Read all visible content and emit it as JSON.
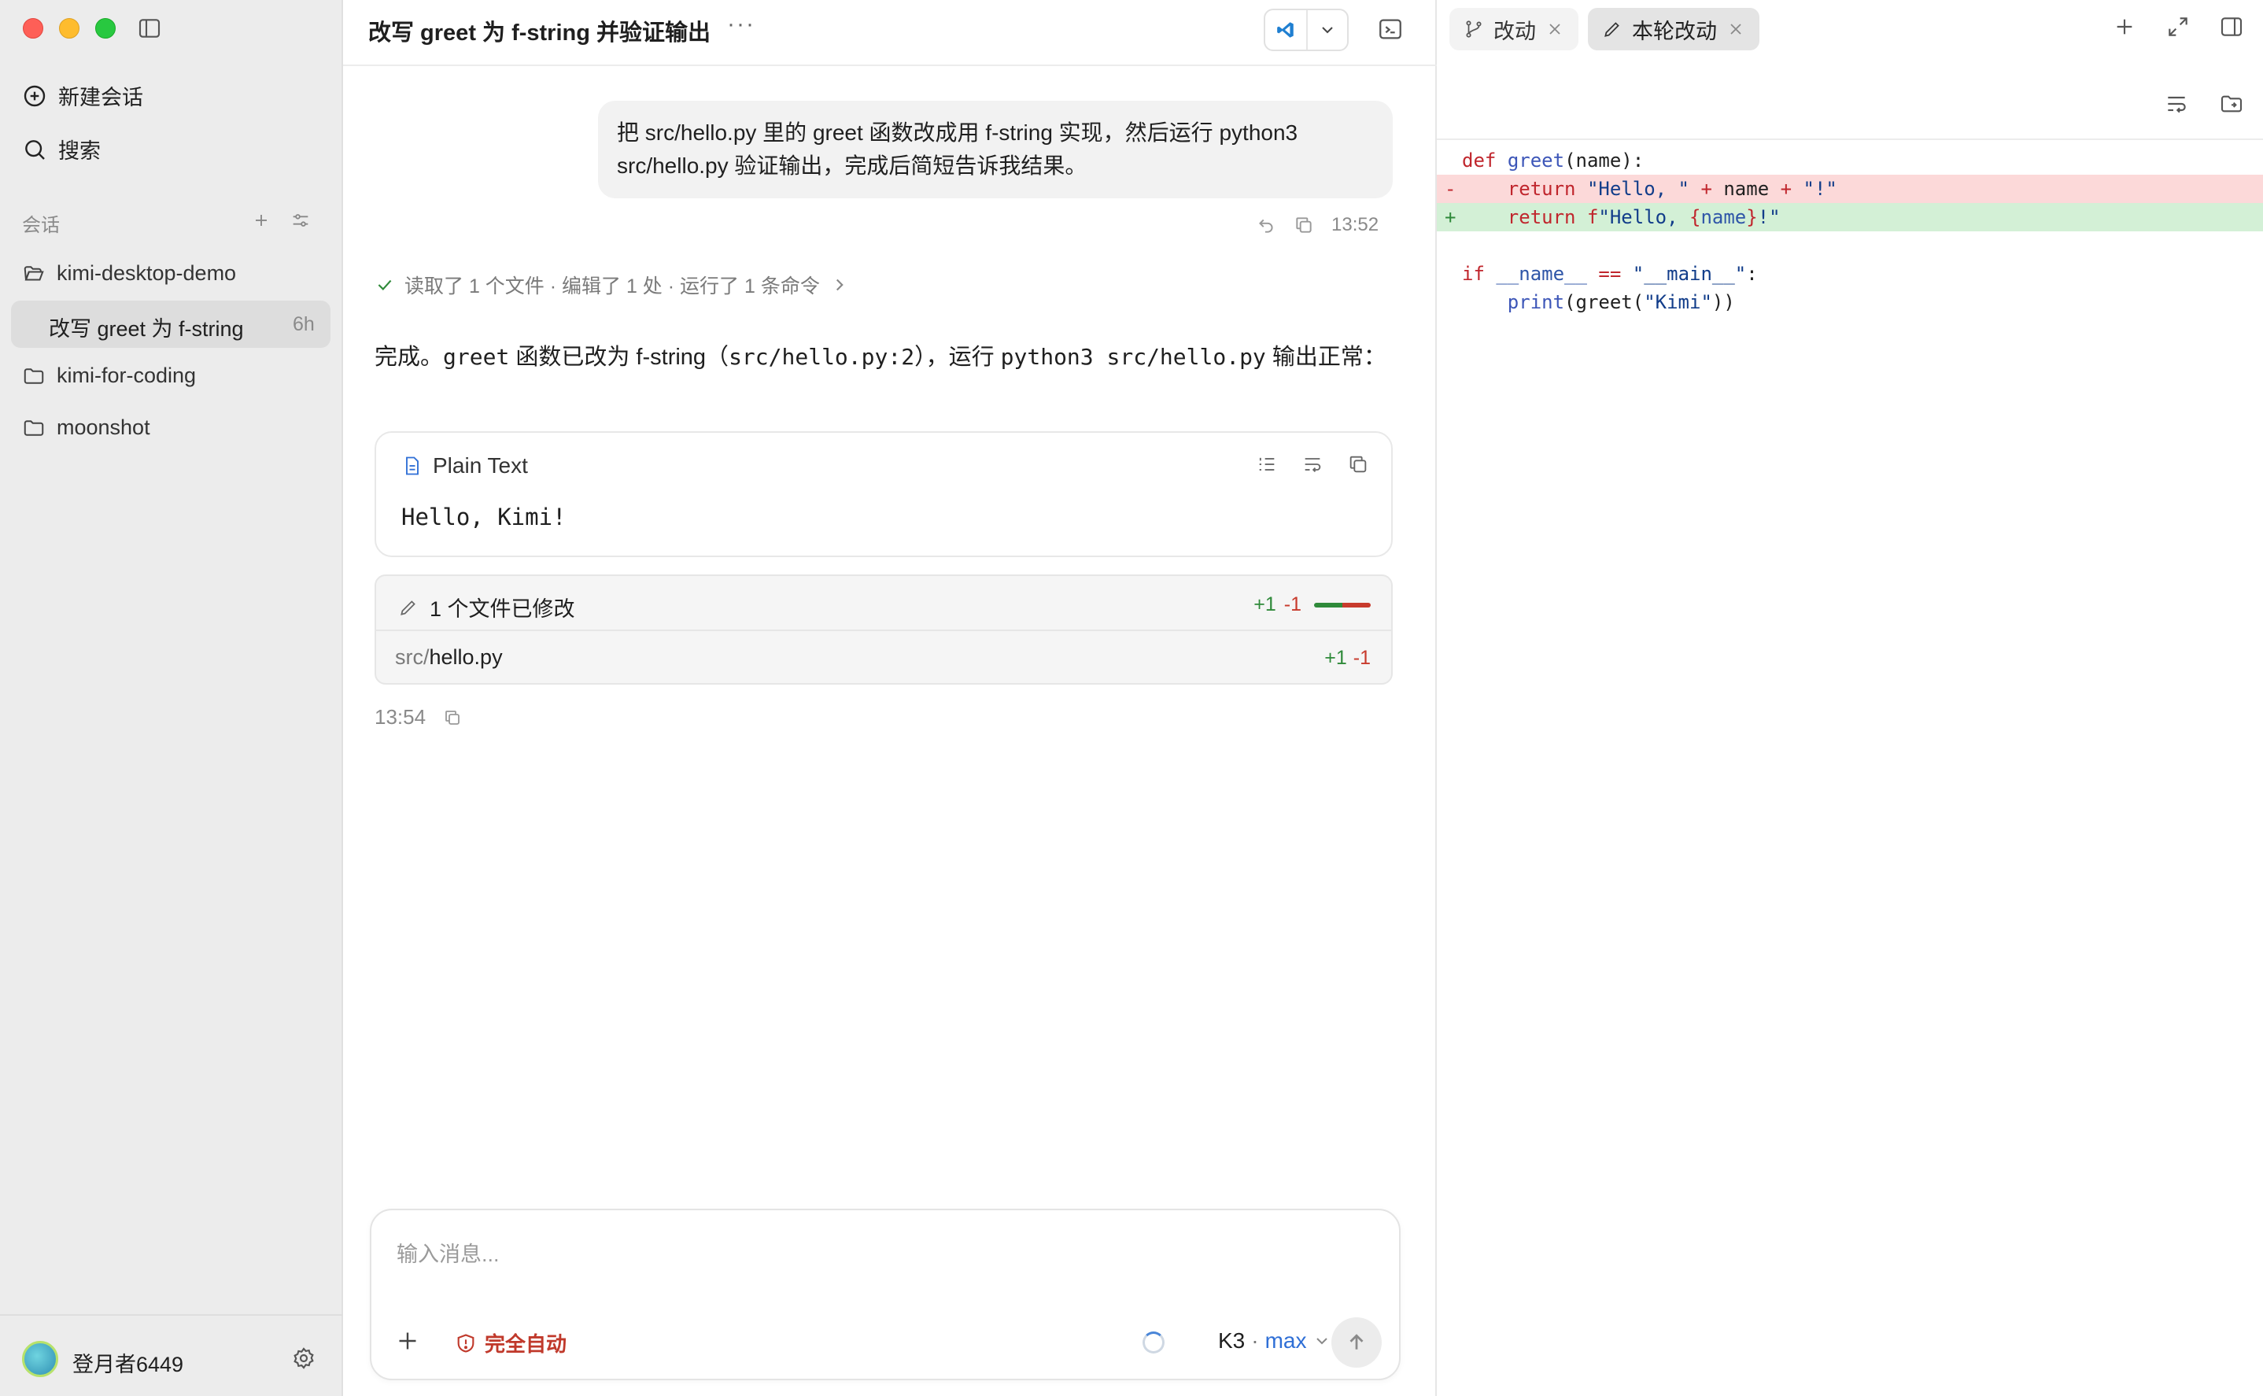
{
  "sidebar": {
    "new_chat": "新建会话",
    "search": "搜索",
    "section_label": "会话",
    "folders": [
      {
        "label": "kimi-desktop-demo"
      },
      {
        "label": "kimi-for-coding"
      },
      {
        "label": "moonshot"
      }
    ],
    "active_session": {
      "label": "改写 greet 为 f-string",
      "time": "6h"
    },
    "user": "登月者6449"
  },
  "chat": {
    "title": "改写 greet 为 f-string 并验证输出",
    "more": "···",
    "user_message": "把 src/hello.py 里的 greet 函数改成用 f-string 实现，然后运行 python3 src/hello.py 验证输出，完成后简短告诉我结果。",
    "user_message_time": "13:52",
    "summary": "读取了 1 个文件 · 编辑了 1 处 · 运行了 1 条命令",
    "reply": {
      "prefix": "完成。",
      "code1": "greet",
      "mid1": " 函数已改为 f-string（",
      "code2": "src/hello.py:2",
      "mid2": "），运行 ",
      "code3": "python3 src/hello.py",
      "suffix": " 输出正常："
    },
    "code_block": {
      "language": "Plain Text",
      "output": "Hello, Kimi!"
    },
    "files_changed": {
      "label": "1 个文件已修改",
      "added": "+1",
      "removed": "-1",
      "file_dir": "src/",
      "file_name": "hello.py",
      "file_added": "+1",
      "file_removed": "-1"
    },
    "reply_time": "13:54"
  },
  "composer": {
    "placeholder": "输入消息...",
    "mode": "完全自动",
    "model": "K3",
    "separator": "·",
    "level": "max"
  },
  "diff": {
    "tab1": "改动",
    "tab2": "本轮改动"
  },
  "icons": {
    "new_chat": "plus-circle-icon",
    "search": "search-icon",
    "folder": "folder-icon",
    "settings": "gear-icon",
    "vscode": "vscode-icon",
    "terminal": "terminal-icon"
  },
  "colors": {
    "added": "#2f8a3a",
    "removed": "#c83b2d",
    "accent": "#2f6fd6",
    "danger": "#c0392b"
  }
}
